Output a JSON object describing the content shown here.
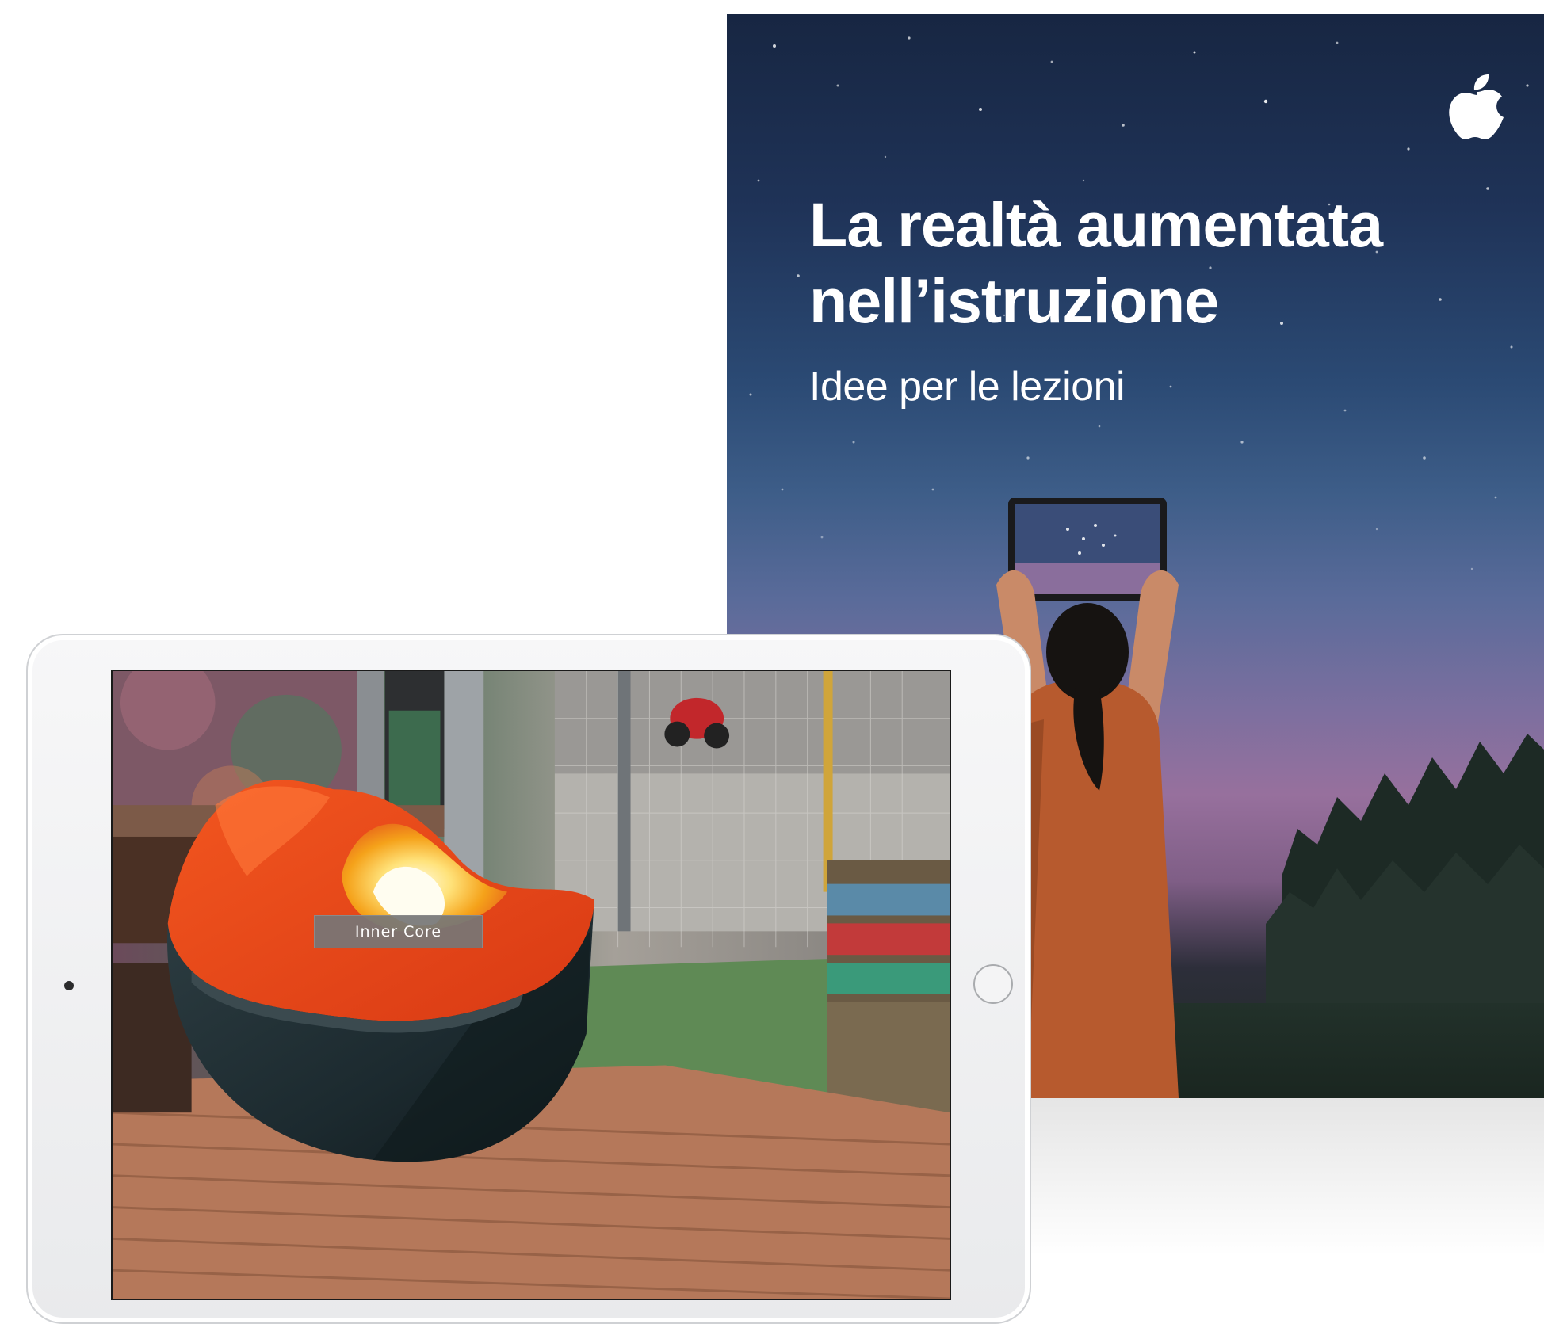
{
  "cover": {
    "brand_icon": "apple-logo-icon",
    "title_line1": "La realtà aumentata",
    "title_line2": "nell’istruzione",
    "subtitle": "Idee per le lezioni"
  },
  "ipad": {
    "ar_label": "Inner Core"
  },
  "colors": {
    "sky_top": "#172642",
    "sky_dusk": "#97709d",
    "earth_mantle": "#e8401e",
    "earth_core": "#fff2b0"
  }
}
